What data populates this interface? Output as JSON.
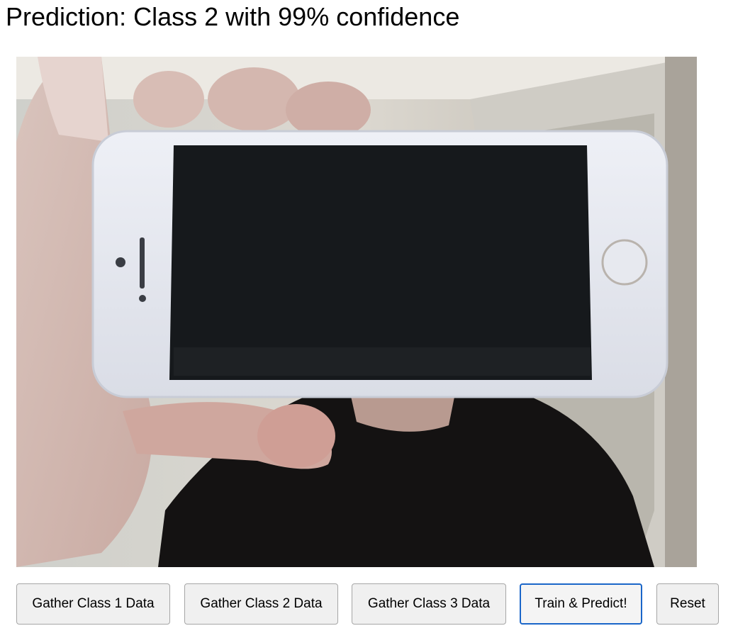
{
  "prediction": {
    "text": "Prediction: Class 2 with 99% confidence"
  },
  "video": {
    "subject": "webcam-feed"
  },
  "buttons": [
    {
      "label": "Gather Class 1 Data"
    },
    {
      "label": "Gather Class 2 Data"
    },
    {
      "label": "Gather Class 3 Data"
    },
    {
      "label": "Train & Predict!"
    },
    {
      "label": "Reset"
    }
  ],
  "colors": {
    "focus_ring": "#1a66c9",
    "button_bg": "#f0f0f0",
    "button_border": "#a6a6a6"
  }
}
